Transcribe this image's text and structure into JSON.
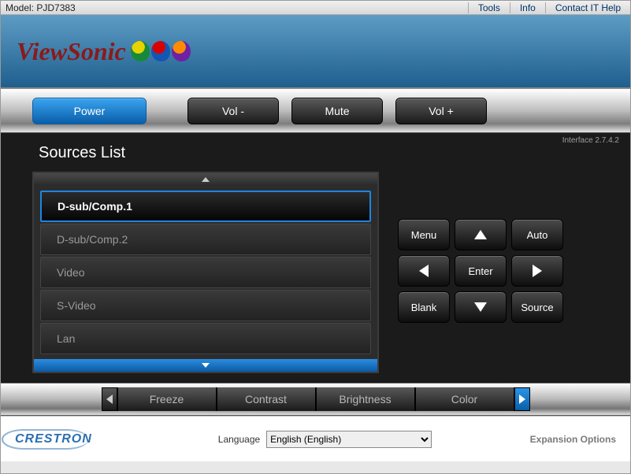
{
  "top": {
    "model_label": "Model: PJD7383",
    "menu": {
      "tools": "Tools",
      "info": "Info",
      "contact": "Contact IT Help"
    }
  },
  "brand": "ViewSonic",
  "ctrl": {
    "power": "Power",
    "vol_down": "Vol -",
    "mute": "Mute",
    "vol_up": "Vol +"
  },
  "interface_version": "Interface 2.7.4.2",
  "sources": {
    "title": "Sources List",
    "items": [
      {
        "label": "D-sub/Comp.1",
        "selected": true
      },
      {
        "label": "D-sub/Comp.2",
        "selected": false
      },
      {
        "label": "Video",
        "selected": false
      },
      {
        "label": "S-Video",
        "selected": false
      },
      {
        "label": "Lan",
        "selected": false
      }
    ]
  },
  "keypad": {
    "menu": "Menu",
    "auto": "Auto",
    "enter": "Enter",
    "blank": "Blank",
    "source": "Source"
  },
  "tabs": {
    "freeze": "Freeze",
    "contrast": "Contrast",
    "brightness": "Brightness",
    "color": "Color"
  },
  "footer": {
    "crestron": "CRESTRON",
    "language_label": "Language",
    "language_value": "English (English)",
    "expansion": "Expansion Options"
  }
}
